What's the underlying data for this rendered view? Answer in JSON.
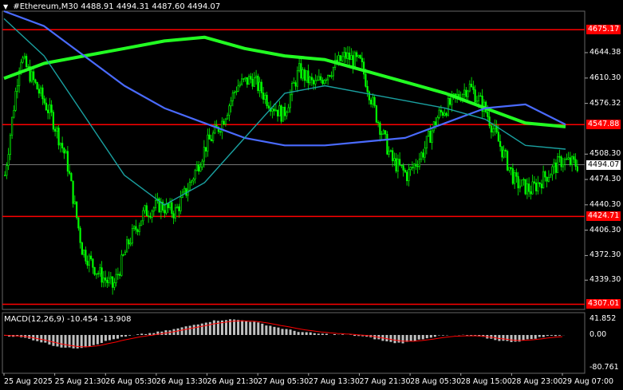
{
  "header": {
    "symbol": "#Ethereum,M30",
    "ohlc": "4488.91 4494.31 4487.60 4494.07"
  },
  "macd_panel": {
    "label": "MACD(12,26,9) -10.454 -13.908",
    "scale_max": "41.852",
    "scale_zero": "0.00",
    "scale_min": "-80.761"
  },
  "price_axis": {
    "labels": [
      "4644.38",
      "4610.30",
      "4576.32",
      "4508.30",
      "4474.30",
      "4440.30",
      "4406.30",
      "4372.30",
      "4339.30"
    ],
    "current_price": "4494.07"
  },
  "levels": [
    {
      "price": "4675.17"
    },
    {
      "price": "4547.88"
    },
    {
      "price": "4424.71"
    },
    {
      "price": "4307.01"
    }
  ],
  "time_axis": {
    "labels": [
      "25 Aug 2025",
      "25 Aug 21:30",
      "26 Aug 05:30",
      "26 Aug 13:30",
      "26 Aug 21:30",
      "27 Aug 05:30",
      "27 Aug 13:30",
      "27 Aug 21:30",
      "28 Aug 05:30",
      "28 Aug 15:00",
      "28 Aug 23:00",
      "29 Aug 07:00"
    ]
  },
  "colors": {
    "background": "#000000",
    "candle": "#00ff00",
    "level_line": "#ff0000",
    "ma_fast": "#1aa0a0",
    "ma_mid": "#4a6bff",
    "ma_slow": "#22ff22",
    "macd_histogram": "#c0c0c0",
    "macd_signal": "#ff0000"
  },
  "chart_data": {
    "type": "candlestick",
    "symbol": "#Ethereum",
    "timeframe": "M30",
    "y_range": [
      4300,
      4700
    ],
    "approx_close_path": [
      4480,
      4640,
      4600,
      4560,
      4500,
      4380,
      4350,
      4330,
      4390,
      4430,
      4440,
      4430,
      4470,
      4520,
      4550,
      4600,
      4610,
      4580,
      4560,
      4620,
      4600,
      4620,
      4640,
      4630,
      4560,
      4500,
      4480,
      4510,
      4560,
      4580,
      4600,
      4570,
      4520,
      4470,
      4460,
      4480,
      4500,
      4494
    ],
    "series": [
      {
        "name": "",
        "kind": "moving-average",
        "values": [
          4610,
          4630,
          4640,
          4650,
          4660,
          4665,
          4650,
          4640,
          4635,
          4620,
          4605,
          4590,
          4570,
          4550,
          4545
        ]
      },
      {
        "name": "",
        "kind": "moving-average",
        "values": [
          4700,
          4680,
          4640,
          4600,
          4570,
          4550,
          4530,
          4520,
          4520,
          4525,
          4530,
          4550,
          4570,
          4575,
          4548
        ]
      },
      {
        "name": "",
        "kind": "moving-average",
        "values": [
          4690,
          4640,
          4560,
          4480,
          4440,
          4470,
          4530,
          4590,
          4600,
          4590,
          4580,
          4570,
          4555,
          4520,
          4515
        ]
      }
    ],
    "levels": [
      4675.17,
      4547.88,
      4424.71,
      4307.01
    ]
  }
}
